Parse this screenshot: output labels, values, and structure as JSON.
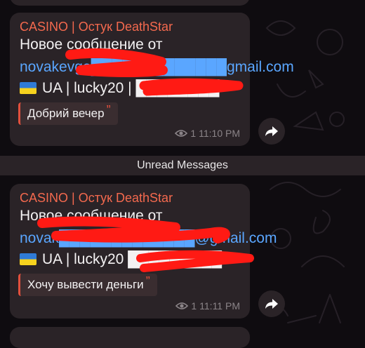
{
  "messages": [
    {
      "sender": "CASINO | Остук DeathStar",
      "line1": "Новое сообщение от",
      "email": "novakevge█████████████gmail.com",
      "info": "UA | lucky20 | ████████",
      "quote": "Добрий вечер",
      "views": "1",
      "time": "11:10 PM"
    },
    {
      "sender": "CASINO | Остук DeathStar",
      "line1": "Новое сообщение от",
      "email": "novak█████████████@gmail.com",
      "info": "UA | lucky20 █████████",
      "quote": "Хочу вывести деньги",
      "views": "1",
      "time": "11:11 PM"
    }
  ],
  "divider": "Unread Messages",
  "icons": {
    "views": "eye-icon",
    "share": "forward-arrow-icon",
    "flag": "ukraine-flag-icon"
  },
  "colors": {
    "background": "#0f0c10",
    "bubble": "#2a2327",
    "sender": "#f4694e",
    "link": "#5aa6ff",
    "quote_bar": "#e2503d",
    "redaction": "#ff1a14"
  }
}
